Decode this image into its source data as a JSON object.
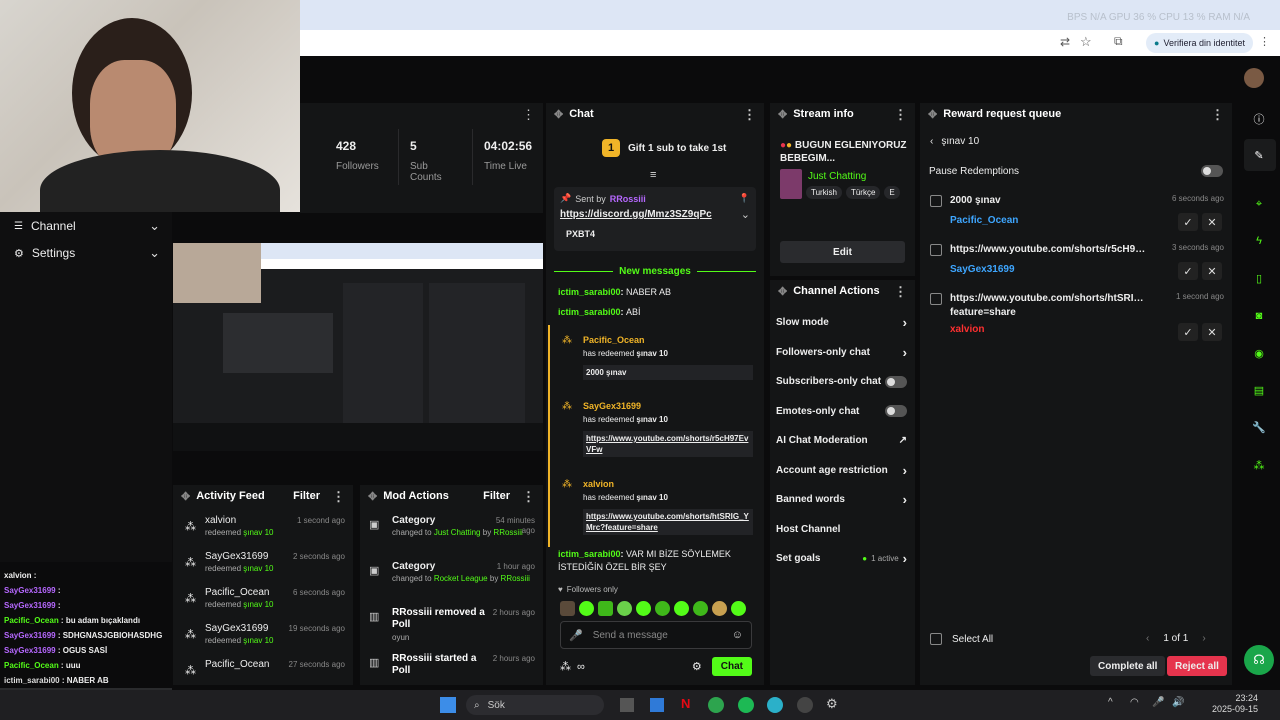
{
  "browser": {
    "stats": "BPS N/A   GPU 36 %   CPU 13 %   RAM N/A",
    "identity_btn": "Verifiera din identitet"
  },
  "sidebar": {
    "channel_label": "Channel",
    "settings_label": "Settings"
  },
  "stats": {
    "followers": {
      "value": "428",
      "label": "Followers"
    },
    "subs": {
      "value": "5",
      "label": "Sub Counts"
    },
    "time": {
      "value": "04:02:56",
      "label": "Time Live"
    }
  },
  "stream_chat_overlay": [
    {
      "user": "xalvion",
      "text": ""
    },
    {
      "user": "SayGex31699",
      "text": ""
    },
    {
      "user": "SayGex31699",
      "text": ""
    },
    {
      "user": "Pacific_Ocean",
      "text": "bu adam bıçaklandı"
    },
    {
      "user": "SayGex31699",
      "text": "SDHGNASJGBIOHASDHG"
    },
    {
      "user": "SayGex31699",
      "text": "OGUS SASİ"
    },
    {
      "user": "Pacific_Ocean",
      "text": "uuu"
    },
    {
      "user": "ictim_sarabi00",
      "text": "NABER AB"
    },
    {
      "user": "ictim_sarabi00",
      "text": "ABİ"
    },
    {
      "user": "ictim_sarabi00",
      "text": "VAR MI BİZE SÖYLEMEK İSTEDİĞİN ÖZEL BİR ŞEY"
    }
  ],
  "activity": {
    "title": "Activity Feed",
    "filter": "Filter",
    "items": [
      {
        "user": "xalvion",
        "action": "redeemed",
        "reward": "şınav 10",
        "time": "1 second ago"
      },
      {
        "user": "SayGex31699",
        "action": "redeemed",
        "reward": "şınav 10",
        "time": "2 seconds ago"
      },
      {
        "user": "Pacific_Ocean",
        "action": "redeemed",
        "reward": "şınav 10",
        "time": "6 seconds ago"
      },
      {
        "user": "SayGex31699",
        "action": "redeemed",
        "reward": "şınav 10",
        "time": "19 seconds ago"
      },
      {
        "user": "Pacific_Ocean",
        "action": "",
        "reward": "",
        "time": "27 seconds ago"
      }
    ]
  },
  "mod": {
    "title": "Mod Actions",
    "filter": "Filter",
    "items": [
      {
        "title": "Category",
        "l1": "changed to",
        "val": "Just Chatting",
        "by": "by",
        "user": "RRossiii",
        "time": "54 minutes ago"
      },
      {
        "title": "Category",
        "l1": "changed to",
        "val": "Rocket League",
        "by": "by",
        "user": "RRossiii",
        "time": "1 hour ago"
      },
      {
        "title": "RRossiii removed a Poll",
        "l1": "oyun",
        "time": "2 hours ago"
      },
      {
        "title": "RRossiii started a Poll",
        "l1": "",
        "time": "2 hours ago"
      }
    ]
  },
  "chat": {
    "title": "Chat",
    "gift": "Gift 1 sub to take 1st",
    "gift_count": "1",
    "pinned_sent_by": "Sent by",
    "pinned_user": "RRossiii",
    "pinned_link": "https://discord.gg/Mmz3SZ9qPc",
    "pinned_sub": "PXBT4",
    "new_messages": "New messages",
    "msgs": [
      {
        "user": "ictim_sarabi00",
        "text": "NABER AB"
      },
      {
        "user": "ictim_sarabi00",
        "text": "ABİ"
      }
    ],
    "redeems": [
      {
        "user": "Pacific_Ocean",
        "line": "has redeemed",
        "reward": "şınav 10",
        "input": "2000 şınav"
      },
      {
        "user": "SayGex31699",
        "line": "has redeemed",
        "reward": "şınav 10",
        "input": "https://www.youtube.com/shorts/r5cH97EvVFw"
      },
      {
        "user": "xalvion",
        "line": "has redeemed",
        "reward": "şınav 10",
        "input": "https://www.youtube.com/shorts/htSRIG_YMrc?feature=share"
      }
    ],
    "last_msg_user": "ictim_sarabi00",
    "last_msg": "VAR MI BİZE SÖYLEMEK İSTEDİĞİN ÖZEL BİR ŞEY",
    "followers_only": "Followers only",
    "placeholder": "Send a message",
    "send": "Chat"
  },
  "stream_info": {
    "title": "Stream info",
    "stream_title": "BUGUN EGLENIYORUZ BEBEGIM...",
    "category": "Just Chatting",
    "tags": [
      "Turkish",
      "Türkçe",
      "E"
    ],
    "edit": "Edit"
  },
  "channel_actions": {
    "title": "Channel Actions",
    "items": [
      {
        "label": "Slow mode",
        "ctrl": "chevron"
      },
      {
        "label": "Followers-only chat",
        "ctrl": "chevron"
      },
      {
        "label": "Subscribers-only chat",
        "ctrl": "toggle"
      },
      {
        "label": "Emotes-only chat",
        "ctrl": "toggle"
      },
      {
        "label": "AI Chat Moderation",
        "ctrl": "chart"
      },
      {
        "label": "Account age restriction",
        "ctrl": "chevron"
      },
      {
        "label": "Banned words",
        "ctrl": "chevron"
      },
      {
        "label": "Host Channel",
        "ctrl": "none"
      },
      {
        "label": "Set goals",
        "ctrl": "chevron",
        "extra": "1 active"
      }
    ]
  },
  "rewards": {
    "title": "Reward request queue",
    "back_label": "şınav 10",
    "pause": "Pause Redemptions",
    "items": [
      {
        "text": "2000 şınav",
        "user": "Pacific_Ocean",
        "time": "6 seconds ago",
        "color": "#3ea6ff"
      },
      {
        "text": "https://www.youtube.com/shorts/r5cH97Ev...",
        "user": "SayGex31699",
        "time": "3 seconds ago",
        "color": "#3ea6ff"
      },
      {
        "text": "https://www.youtube.com/shorts/htSRIG_YMr...",
        "text2": "feature=share",
        "user": "xalvion",
        "time": "1 second ago",
        "color": "#ff3030"
      }
    ],
    "select_all": "Select All",
    "page": "1 of 1",
    "complete_all": "Complete all",
    "reject_all": "Reject all"
  },
  "taskbar": {
    "search": "Sök",
    "time": "23:24",
    "date": "2025-09-15"
  }
}
